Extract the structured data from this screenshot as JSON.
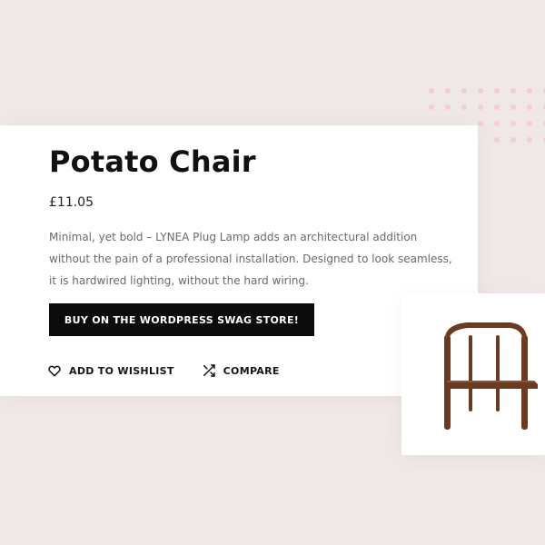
{
  "product": {
    "title": "Potato Chair",
    "price": "£11.05",
    "description": "Minimal, yet bold – LYNEA Plug Lamp adds an architectural addition without the pain of a professional installation. Designed to look seamless, it is hardwired lighting, without the hard wiring.",
    "buy_label": "BUY ON THE WORDPRESS SWAG STORE!",
    "wishlist_label": "ADD TO WISHLIST",
    "compare_label": "COMPARE",
    "image_icon": "chair-image"
  },
  "icons": {
    "wishlist": "heart-icon",
    "compare": "shuffle-icon"
  },
  "colors": {
    "background": "#efe8e6",
    "card": "#ffffff",
    "button": "#0c0c0c",
    "dots": "#f2cfd0",
    "accent_pink": "#d9a1a2",
    "chair_wood": "#6b3a23"
  }
}
